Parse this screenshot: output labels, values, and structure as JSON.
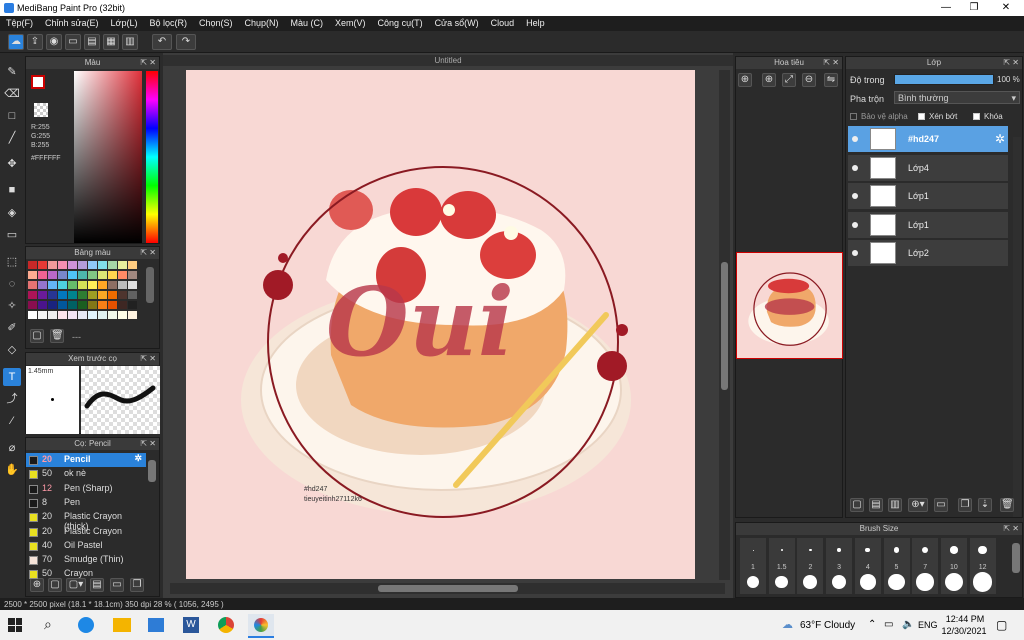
{
  "window": {
    "title": "MediBang Paint Pro (32bit)",
    "controls": [
      "—",
      "❐",
      "✕"
    ]
  },
  "menu": [
    "Tệp(F)",
    "Chỉnh sửa(E)",
    "Lớp(L)",
    "Bộ lọc(R)",
    "Chọn(S)",
    "Chụp(N)",
    "Màu (C)",
    "Xem(V)",
    "Công cụ(T)",
    "Cửa sổ(W)",
    "Cloud",
    "Help"
  ],
  "color_panel": {
    "title": "Màu",
    "r": "R:255",
    "g": "G:255",
    "b": "B:255",
    "hex": "#FFFFFF",
    "fg": "#ffffff",
    "accent": "#c0303a"
  },
  "palette_panel": {
    "title": "Bảng màu",
    "more": "---"
  },
  "preview_panel": {
    "title": "Xem trước cọ",
    "size": "1.45mm"
  },
  "brush_panel": {
    "title": "Cọ: Pencil",
    "items": [
      {
        "size": "20",
        "name": "Pencil",
        "color": "#1a1a1a"
      },
      {
        "size": "50",
        "name": "ok nè",
        "color": "#e8e020"
      },
      {
        "size": "12",
        "name": "Pen (Sharp)",
        "color": "#1a1a1a"
      },
      {
        "size": "8",
        "name": "Pen",
        "color": "#1a1a1a"
      },
      {
        "size": "20",
        "name": "Plastic Crayon (thick)",
        "color": "#e8e020"
      },
      {
        "size": "20",
        "name": "Plastic Crayon",
        "color": "#e8e020"
      },
      {
        "size": "40",
        "name": "Oil Pastel",
        "color": "#e8e020"
      },
      {
        "size": "70",
        "name": "Smudge (Thin)",
        "color": "#f5e3d8"
      },
      {
        "size": "50",
        "name": "Crayon",
        "color": "#e8e020"
      }
    ]
  },
  "canvas": {
    "tab": "Untitled",
    "caption_line1": "#hd247",
    "caption_line2": "tieuyeitinh27112k6",
    "art_text": "Oui"
  },
  "navigator": {
    "title": "Hoa tiêu"
  },
  "layers_panel": {
    "title": "Lớp",
    "opacity_label": "Độ trong",
    "opacity_value": "100 %",
    "opacity": 1.0,
    "blend_label": "Pha trộn",
    "blend_value": "Bình thường",
    "protect_alpha": "Bảo vệ alpha",
    "clipping": "Xén bớt",
    "lock": "Khóa",
    "layers": [
      {
        "name": "#hd247",
        "selected": true
      },
      {
        "name": "Lớp4",
        "selected": false
      },
      {
        "name": "Lớp1",
        "selected": false
      },
      {
        "name": "Lớp1",
        "selected": false
      },
      {
        "name": "Lớp2",
        "selected": false
      }
    ]
  },
  "brush_size_panel": {
    "title": "Brush Size",
    "labels": [
      "1",
      "1.5",
      "2",
      "3",
      "4",
      "5",
      "7",
      "10",
      "12"
    ]
  },
  "status": {
    "text": "2500 * 2500 pixel  (18.1 * 18.1cm)  350 dpi   28 %  ( 1056, 2495 )"
  },
  "taskbar": {
    "weather": "63°F  Cloudy",
    "lang": "ENG",
    "time": "12:44 PM",
    "date": "12/30/2021"
  }
}
